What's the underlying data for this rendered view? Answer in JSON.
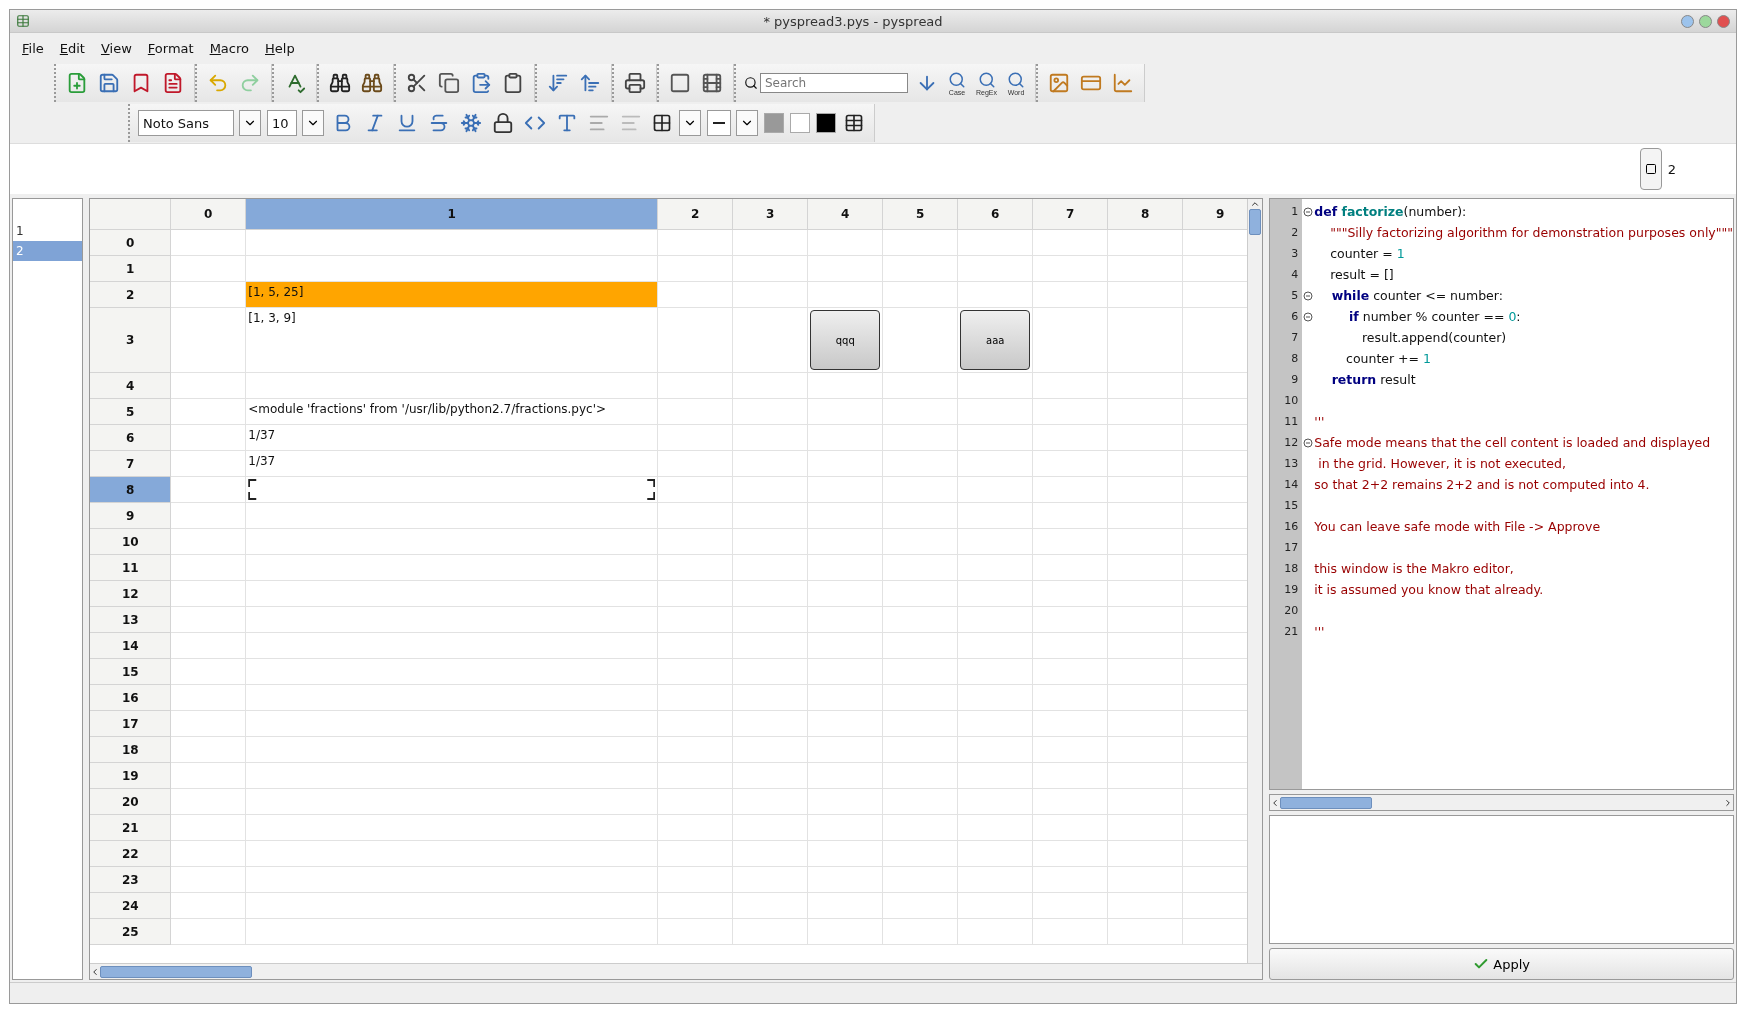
{
  "window": {
    "title": "* pyspread3.pys - pyspread"
  },
  "menu": [
    "File",
    "Edit",
    "View",
    "Format",
    "Macro",
    "Help"
  ],
  "search": {
    "placeholder": "Search"
  },
  "search_options": [
    "Case",
    "RegEx",
    "Word"
  ],
  "format_bar": {
    "font": "Noto Sans",
    "size": "10"
  },
  "entry_line": {
    "table_number": "2"
  },
  "sheets": [
    {
      "label": "1",
      "selected": false
    },
    {
      "label": "2",
      "selected": true
    }
  ],
  "table": {
    "columns": [
      {
        "label": "0",
        "selected": false
      },
      {
        "label": "1",
        "selected": true
      },
      {
        "label": "2",
        "selected": false
      },
      {
        "label": "3",
        "selected": false
      },
      {
        "label": "4",
        "selected": false
      },
      {
        "label": "5",
        "selected": false
      },
      {
        "label": "6",
        "selected": false
      },
      {
        "label": "7",
        "selected": false
      },
      {
        "label": "8",
        "selected": false
      },
      {
        "label": "9",
        "selected": false
      }
    ],
    "rows": [
      {
        "label": "0",
        "selected": false
      },
      {
        "label": "1",
        "selected": false
      },
      {
        "label": "2",
        "selected": false,
        "cells": [
          null,
          {
            "kind": "text",
            "text": "[1, 5, 25]",
            "color": "#ffa500"
          }
        ]
      },
      {
        "label": "3",
        "selected": false,
        "cells": [
          null,
          {
            "kind": "text",
            "text": "[1, 3, 9]"
          },
          null,
          null,
          {
            "kind": "button",
            "text": "qqq"
          },
          null,
          {
            "kind": "button",
            "text": "aaa"
          }
        ]
      },
      {
        "label": "4",
        "selected": false
      },
      {
        "label": "5",
        "selected": false,
        "cells": [
          null,
          {
            "kind": "text",
            "text": "<module 'fractions' from '/usr/lib/python2.7/fractions.pyc'>"
          }
        ]
      },
      {
        "label": "6",
        "selected": false,
        "cells": [
          null,
          {
            "kind": "text",
            "text": "1/37"
          }
        ]
      },
      {
        "label": "7",
        "selected": false,
        "cells": [
          null,
          {
            "kind": "text",
            "text": "1/37"
          }
        ]
      },
      {
        "label": "8",
        "selected": true,
        "cells": [
          null,
          {
            "kind": "cursor"
          }
        ]
      },
      {
        "label": "9",
        "selected": false
      },
      {
        "label": "10",
        "selected": false
      },
      {
        "label": "11",
        "selected": false
      },
      {
        "label": "12",
        "selected": false
      },
      {
        "label": "13",
        "selected": false
      },
      {
        "label": "14",
        "selected": false
      },
      {
        "label": "15",
        "selected": false
      },
      {
        "label": "16",
        "selected": false
      },
      {
        "label": "17",
        "selected": false
      },
      {
        "label": "18",
        "selected": false
      },
      {
        "label": "19",
        "selected": false
      },
      {
        "label": "20",
        "selected": false
      },
      {
        "label": "21",
        "selected": false
      },
      {
        "label": "22",
        "selected": false
      },
      {
        "label": "23",
        "selected": false
      },
      {
        "label": "24",
        "selected": false
      },
      {
        "label": "25",
        "selected": false
      }
    ]
  },
  "macro_editor": {
    "lines": [
      {
        "number": "1",
        "foldable": true,
        "tokens": [
          {
            "kind": "keyword",
            "text": "def"
          },
          {
            "kind": "function",
            "text": " factorize"
          },
          {
            "kind": "plain",
            "text": "(number):"
          }
        ]
      },
      {
        "number": "2",
        "foldable": false,
        "tokens": [
          {
            "kind": "string",
            "text": "    \"\"\"Silly factorizing algorithm for demonstration purposes only\"\"\""
          }
        ]
      },
      {
        "number": "3",
        "foldable": false,
        "tokens": [
          {
            "kind": "plain",
            "text": "    counter = "
          },
          {
            "kind": "number",
            "text": "1"
          }
        ]
      },
      {
        "number": "4",
        "foldable": false,
        "tokens": [
          {
            "kind": "plain",
            "text": "    result = []"
          }
        ]
      },
      {
        "number": "5",
        "foldable": true,
        "tokens": [
          {
            "kind": "keyword",
            "text": "    while"
          },
          {
            "kind": "plain",
            "text": " counter <= number:"
          }
        ]
      },
      {
        "number": "6",
        "foldable": true,
        "tokens": [
          {
            "kind": "keyword",
            "text": "        if"
          },
          {
            "kind": "plain",
            "text": " number % counter == "
          },
          {
            "kind": "number",
            "text": "0"
          },
          {
            "kind": "plain",
            "text": ":"
          }
        ]
      },
      {
        "number": "7",
        "foldable": false,
        "tokens": [
          {
            "kind": "plain",
            "text": "            result.append(counter)"
          }
        ]
      },
      {
        "number": "8",
        "foldable": false,
        "tokens": [
          {
            "kind": "plain",
            "text": "        counter += "
          },
          {
            "kind": "number",
            "text": "1"
          }
        ]
      },
      {
        "number": "9",
        "foldable": false,
        "tokens": [
          {
            "kind": "keyword",
            "text": "    return"
          },
          {
            "kind": "plain",
            "text": " result"
          }
        ]
      },
      {
        "number": "10",
        "foldable": false
      },
      {
        "number": "11",
        "foldable": false,
        "tokens": [
          {
            "kind": "string",
            "text": "'''"
          }
        ]
      },
      {
        "number": "12",
        "foldable": true,
        "tokens": [
          {
            "kind": "string",
            "text": "Safe mode means that the cell content is loaded and displayed"
          }
        ]
      },
      {
        "number": "13",
        "foldable": false,
        "tokens": [
          {
            "kind": "string",
            "text": " in the grid. However, it is not executed,"
          }
        ]
      },
      {
        "number": "14",
        "foldable": false,
        "tokens": [
          {
            "kind": "string",
            "text": "so that 2+2 remains 2+2 and is not computed into 4."
          }
        ]
      },
      {
        "number": "15",
        "foldable": false
      },
      {
        "number": "16",
        "foldable": false,
        "tokens": [
          {
            "kind": "string",
            "text": "You can leave safe mode with File -> Approve"
          }
        ]
      },
      {
        "number": "17",
        "foldable": false
      },
      {
        "number": "18",
        "foldable": false,
        "tokens": [
          {
            "kind": "string",
            "text": "this window is the Makro editor,"
          }
        ]
      },
      {
        "number": "19",
        "foldable": false,
        "tokens": [
          {
            "kind": "string",
            "text": "it is assumed you know that already."
          }
        ]
      },
      {
        "number": "20",
        "foldable": false
      },
      {
        "number": "21",
        "foldable": false,
        "tokens": [
          {
            "kind": "string",
            "text": "'''"
          }
        ]
      }
    ]
  },
  "apply_button": {
    "label": "Apply"
  }
}
